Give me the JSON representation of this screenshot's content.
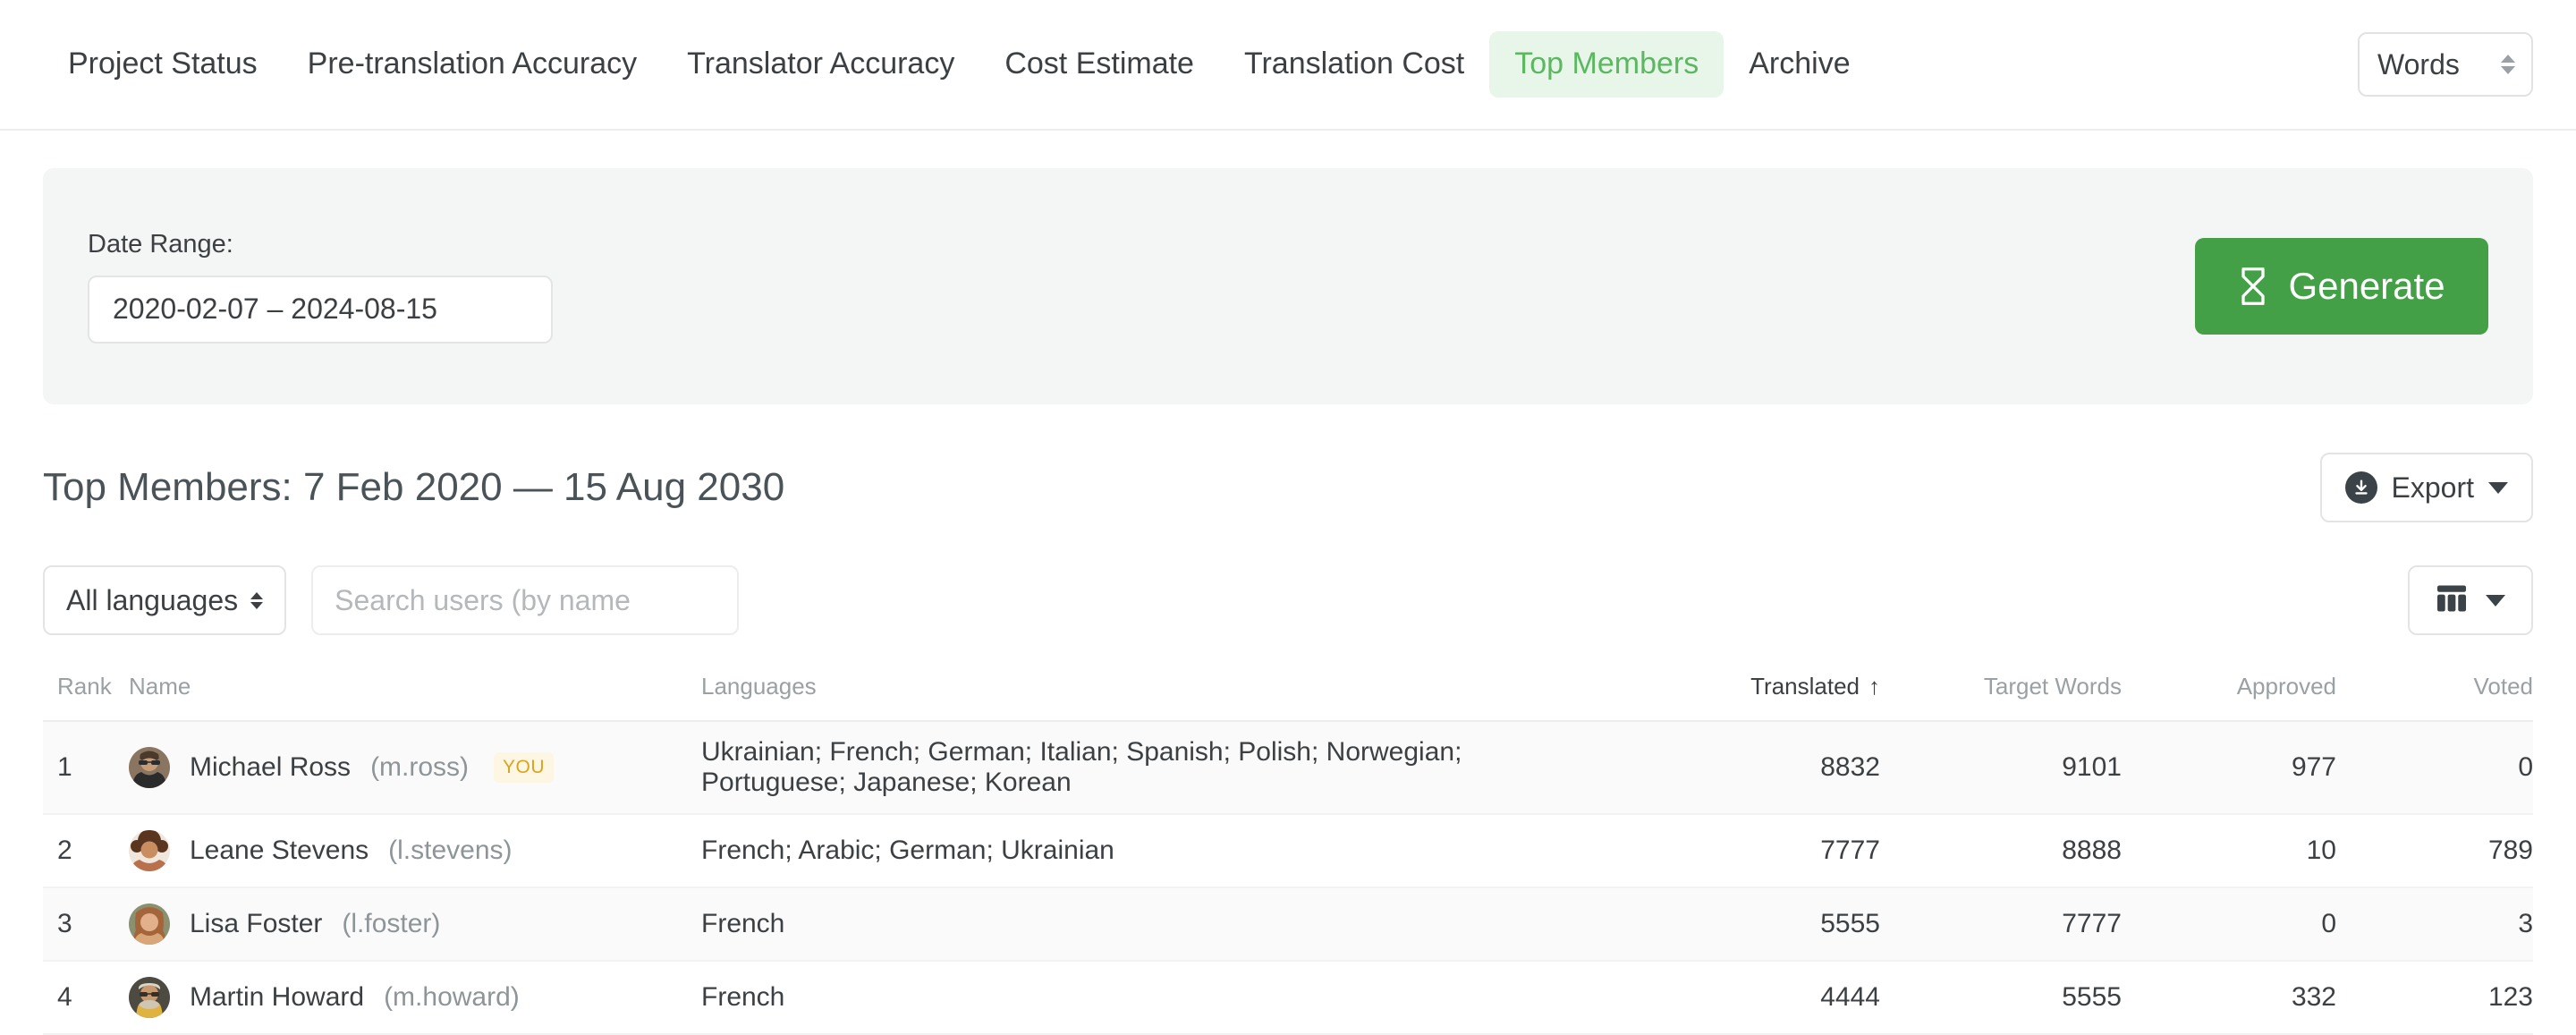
{
  "nav": {
    "tabs": [
      {
        "label": "Project Status",
        "active": false
      },
      {
        "label": "Pre-translation Accuracy",
        "active": false
      },
      {
        "label": "Translator Accuracy",
        "active": false
      },
      {
        "label": "Cost Estimate",
        "active": false
      },
      {
        "label": "Translation Cost",
        "active": false
      },
      {
        "label": "Top Members",
        "active": true
      },
      {
        "label": "Archive",
        "active": false
      }
    ],
    "unit_select": {
      "value": "Words",
      "icon": "spinner-arrows-icon"
    },
    "active_tab_color": "#5cb860",
    "active_tab_bg": "#e8f6ea"
  },
  "filters": {
    "date_range_label": "Date Range:",
    "date_range_value": "2020-02-07 – 2024-08-15",
    "generate_label": "Generate",
    "generate_icon": "hourglass-icon",
    "generate_color": "#44a047"
  },
  "report": {
    "title": "Top Members: 7 Feb 2020 — 15 Aug 2030",
    "export_label": "Export",
    "export_icon": "download-circle-icon",
    "export_caret": "caret-down-icon"
  },
  "toolbar": {
    "language_filter": "All languages",
    "search_placeholder": "Search users (by name",
    "search_value": "",
    "columns_icon": "columns-table-icon",
    "columns_caret": "caret-down-icon"
  },
  "table": {
    "columns": [
      {
        "key": "rank",
        "label": "Rank",
        "align": "left"
      },
      {
        "key": "name",
        "label": "Name",
        "align": "left"
      },
      {
        "key": "languages",
        "label": "Languages",
        "align": "left"
      },
      {
        "key": "translated",
        "label": "Translated",
        "align": "right",
        "sorted": true,
        "sort_dir": "asc",
        "sort_icon": "↑"
      },
      {
        "key": "target_words",
        "label": "Target Words",
        "align": "right"
      },
      {
        "key": "approved",
        "label": "Approved",
        "align": "right"
      },
      {
        "key": "voted",
        "label": "Voted",
        "align": "right"
      }
    ],
    "rows": [
      {
        "rank": "1",
        "name": "Michael Ross",
        "username": "(m.ross)",
        "badge": "YOU",
        "avatar": "avatar-michael-ross",
        "languages": "Ukrainian; French; German; Italian; Spanish; Polish; Norwegian; Portuguese; Japanese; Korean",
        "translated": "8832",
        "target_words": "9101",
        "approved": "977",
        "voted": "0"
      },
      {
        "rank": "2",
        "name": "Leane Stevens",
        "username": "(l.stevens)",
        "badge": "",
        "avatar": "avatar-leane-stevens",
        "languages": "French; Arabic; German; Ukrainian",
        "translated": "7777",
        "target_words": "8888",
        "approved": "10",
        "voted": "789"
      },
      {
        "rank": "3",
        "name": "Lisa Foster",
        "username": "(l.foster)",
        "badge": "",
        "avatar": "avatar-lisa-foster",
        "languages": "French",
        "translated": "5555",
        "target_words": "7777",
        "approved": "0",
        "voted": "3"
      },
      {
        "rank": "4",
        "name": "Martin Howard",
        "username": "(m.howard)",
        "badge": "",
        "avatar": "avatar-martin-howard",
        "languages": "French",
        "translated": "4444",
        "target_words": "5555",
        "approved": "332",
        "voted": "123"
      }
    ]
  }
}
